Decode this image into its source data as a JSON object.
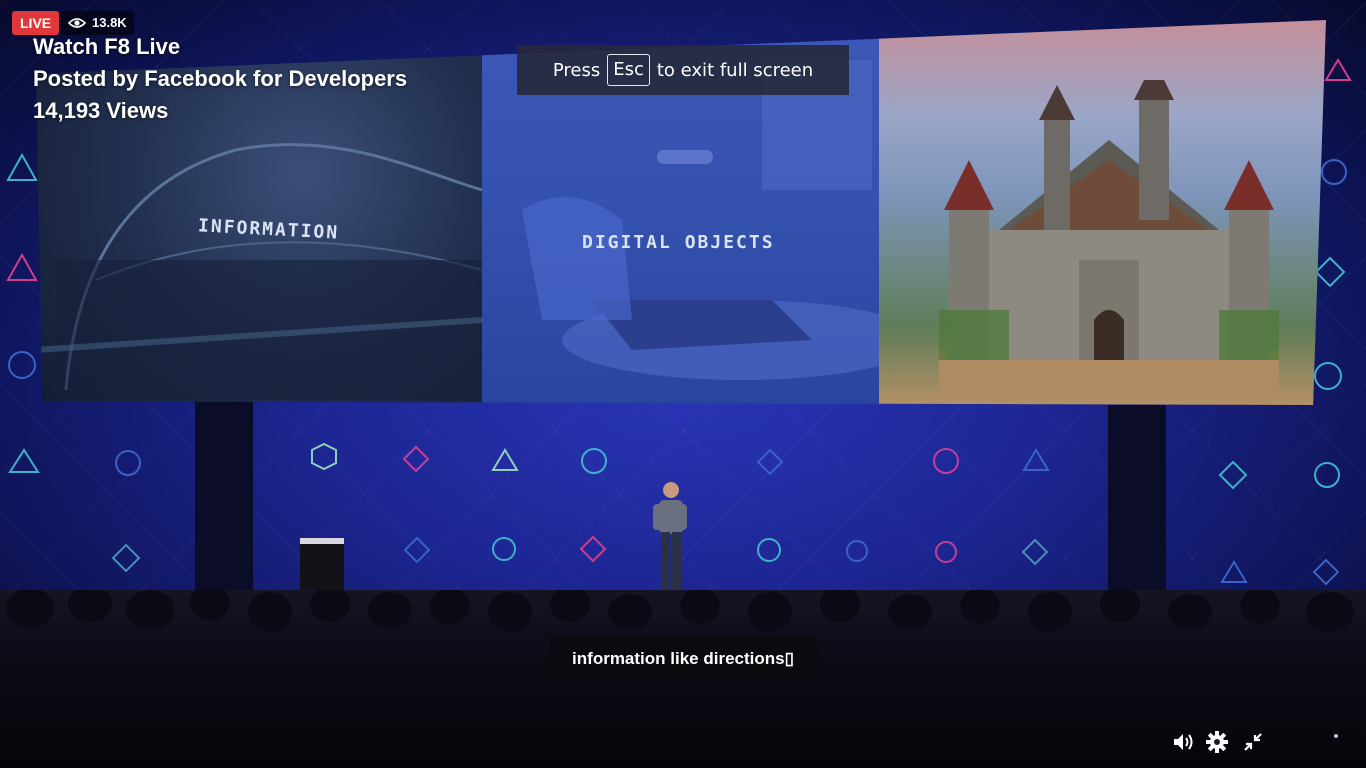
{
  "live_badge": {
    "label": "LIVE",
    "color": "#e0383a"
  },
  "viewer_count": {
    "icon": "eye-icon",
    "value": "13.8K"
  },
  "video_info": {
    "title": "Watch F8 Live",
    "posted_by": "Posted by Facebook for Developers",
    "views": "14,193 Views"
  },
  "fullscreen_notice": {
    "prefix": "Press",
    "key": "Esc",
    "suffix": "to exit full screen"
  },
  "caption": {
    "text": "information like directions▯"
  },
  "slides": {
    "panel1_label": "INFORMATION",
    "panel2_label": "DIGITAL OBJECTS"
  },
  "controls": {
    "volume_icon": "volume-icon",
    "settings_icon": "gear-icon",
    "exit_fullscreen_icon": "exit-fullscreen-icon"
  },
  "colors": {
    "accent_live": "#e0383a",
    "stage_blue": "#1c2590",
    "overlay_dark": "#262838"
  }
}
